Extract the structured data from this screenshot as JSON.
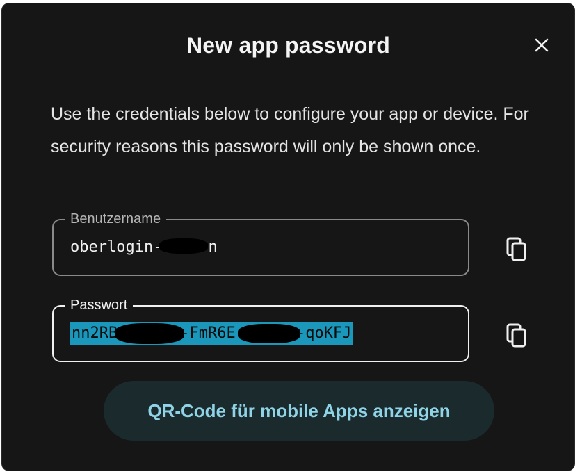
{
  "dialog": {
    "title": "New app password",
    "description": "Use the credentials below to configure your app or device. For security reasons this password will only be shown once.",
    "close_icon": "close-icon"
  },
  "username_field": {
    "label": "Benutzername",
    "value_visible": "oberlogin-",
    "value_tail": "n",
    "copy_icon": "copy-icon"
  },
  "password_field": {
    "label": "Passwort",
    "value_part1": "nn2RB",
    "value_part2": "-FmR6E-",
    "value_part3": "-qoKFJ",
    "selected": true,
    "copy_icon": "copy-icon"
  },
  "qr_button": {
    "label": "QR-Code für mobile Apps anzeigen"
  },
  "colors": {
    "dialog_bg": "#161616",
    "selection": "#1a97bb",
    "button_bg": "#1b2a2d",
    "button_text": "#8fd3e6"
  }
}
